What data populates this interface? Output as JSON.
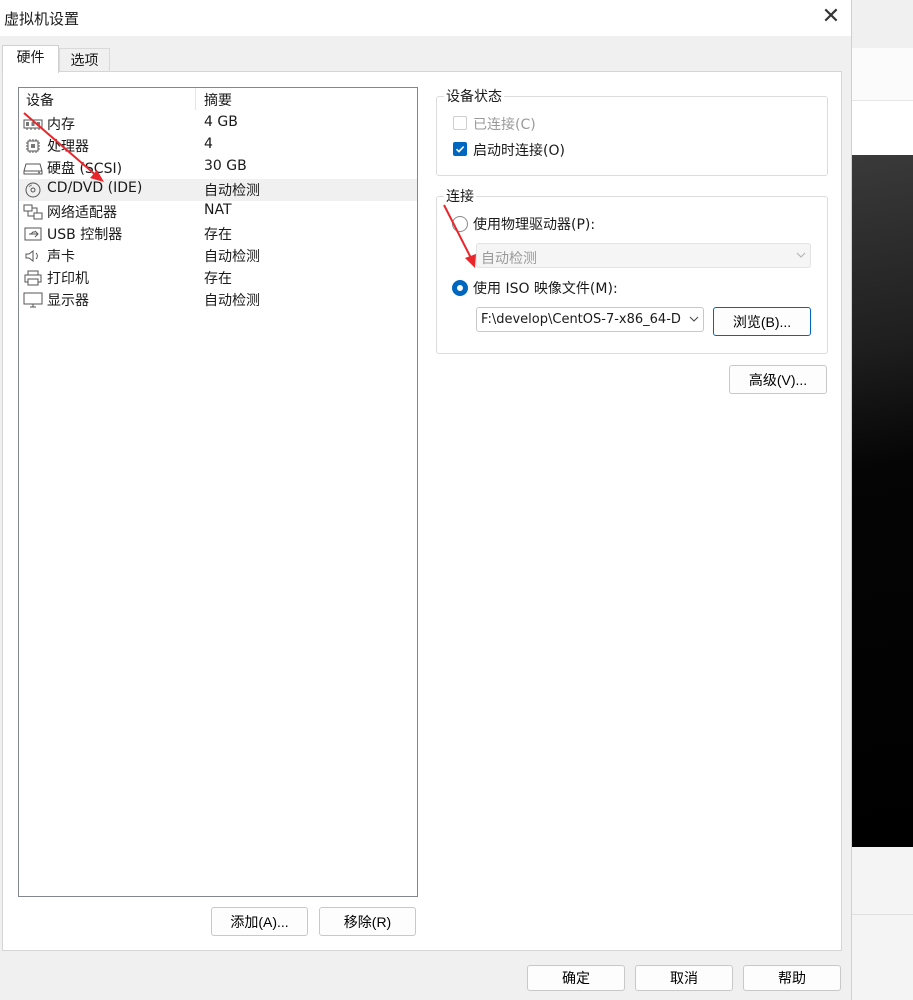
{
  "window": {
    "title": "虚拟机设置",
    "close_symbol": "✕"
  },
  "tabs": [
    {
      "label": "硬件",
      "active": true
    },
    {
      "label": "选项",
      "active": false
    }
  ],
  "device_list": {
    "headers": {
      "device": "设备",
      "summary": "摘要"
    },
    "rows": [
      {
        "icon": "memory-icon",
        "name": "内存",
        "summary": "4 GB",
        "selected": false
      },
      {
        "icon": "processor-icon",
        "name": "处理器",
        "summary": "4",
        "selected": false
      },
      {
        "icon": "hard-disk-icon",
        "name": "硬盘 (SCSI)",
        "summary": "30 GB",
        "selected": false
      },
      {
        "icon": "cd-dvd-icon",
        "name": "CD/DVD (IDE)",
        "summary": "自动检测",
        "selected": true
      },
      {
        "icon": "network-adapter-icon",
        "name": "网络适配器",
        "summary": "NAT",
        "selected": false
      },
      {
        "icon": "usb-controller-icon",
        "name": "USB 控制器",
        "summary": "存在",
        "selected": false
      },
      {
        "icon": "sound-card-icon",
        "name": "声卡",
        "summary": "自动检测",
        "selected": false
      },
      {
        "icon": "printer-icon",
        "name": "打印机",
        "summary": "存在",
        "selected": false
      },
      {
        "icon": "display-icon",
        "name": "显示器",
        "summary": "自动检测",
        "selected": false
      }
    ],
    "add_label": "添加(A)...",
    "remove_label": "移除(R)"
  },
  "device_status": {
    "label": "设备状态",
    "connected": {
      "label": "已连接(C)",
      "checked": false,
      "enabled": false
    },
    "connect_at_power_on": {
      "label": "启动时连接(O)",
      "checked": true,
      "enabled": true
    }
  },
  "connection": {
    "label": "连接",
    "physical": {
      "label": "使用物理驱动器(P):",
      "selected": false,
      "drive_value": "自动检测"
    },
    "iso": {
      "label": "使用 ISO 映像文件(M):",
      "selected": true,
      "path_value": "F:\\develop\\CentOS-7-x86_64-D"
    },
    "browse_label": "浏览(B)..."
  },
  "advanced_label": "高级(V)...",
  "footer": {
    "ok": "确定",
    "cancel": "取消",
    "help": "帮助"
  },
  "colors": {
    "accent": "#0067c0",
    "annotation_arrow": "#e8262b",
    "selected_row": "#f0f0f0"
  }
}
